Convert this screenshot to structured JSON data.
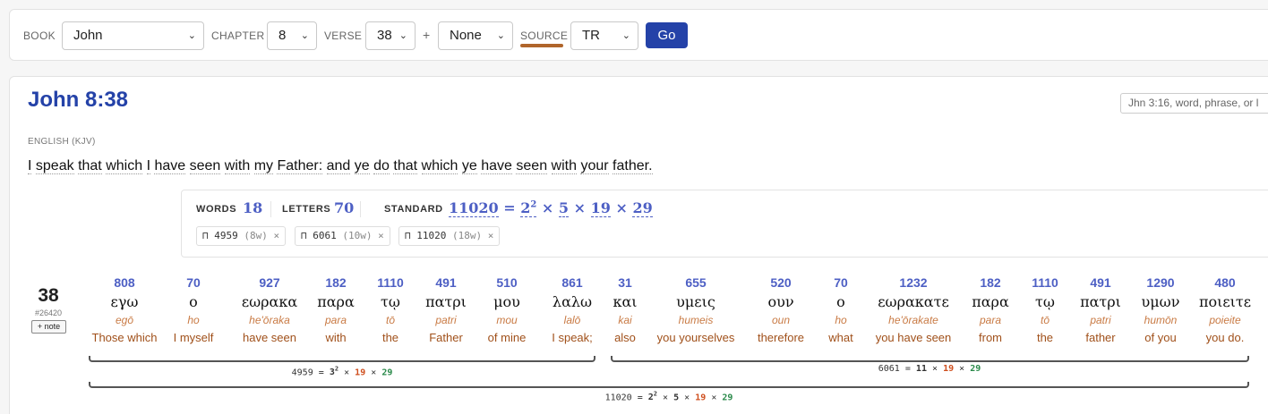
{
  "toolbar": {
    "book_label": "BOOK",
    "book_value": "John",
    "chapter_label": "CHAPTER",
    "chapter_value": "8",
    "verse_label": "VERSE",
    "verse_value": "38",
    "plus": "+",
    "range_value": "None",
    "source_label": "SOURCE",
    "source_value": "TR",
    "go_label": "Go",
    "chevron": "⌄",
    "accent_color": "#2442a8",
    "source_underline_color": "#b0652b"
  },
  "main": {
    "reference": "John 8:38",
    "search_placeholder": "Jhn 3:16, word, phrase, or l",
    "translation_label": "ENGLISH (KJV)",
    "english_words": [
      "I",
      "speak",
      "that",
      "which",
      "I",
      "have",
      "seen",
      "with",
      "my",
      "Father:",
      "and",
      "ye",
      "do",
      "that",
      "which",
      "ye",
      "have",
      "seen",
      "with",
      "your",
      "father."
    ]
  },
  "stats": {
    "words_label": "WORDS",
    "words_value": "18",
    "letters_label": "LETTERS",
    "letters_value": "70",
    "standard_label": "STANDARD",
    "standard_value": "11020",
    "eq": "=",
    "f1_base": "2",
    "f1_exp": "2",
    "times": "×",
    "f2": "5",
    "f3": "19",
    "f4": "29",
    "chips": [
      {
        "icon": "⊓",
        "value": "4959",
        "words": "(8w)",
        "close": "×"
      },
      {
        "icon": "⊓",
        "value": "6061",
        "words": "(10w)",
        "close": "×"
      },
      {
        "icon": "⊓",
        "value": "11020",
        "words": "(18w)",
        "close": "×"
      }
    ]
  },
  "verse": {
    "number": "38",
    "id": "#26420",
    "note_label": "+ note"
  },
  "words": [
    {
      "num": "808",
      "greek": "εγω",
      "translit": "egō",
      "gloss": "Those which"
    },
    {
      "num": "70",
      "greek": "ο",
      "translit": "ho",
      "gloss": "I myself"
    },
    {
      "num": "927",
      "greek": "εωρακα",
      "translit": "he'ōraka",
      "gloss": "have seen"
    },
    {
      "num": "182",
      "greek": "παρα",
      "translit": "para",
      "gloss": "with"
    },
    {
      "num": "1110",
      "greek": "τῳ",
      "translit": "tō",
      "gloss": "the"
    },
    {
      "num": "491",
      "greek": "πατρι",
      "translit": "patri",
      "gloss": "Father"
    },
    {
      "num": "510",
      "greek": "μου",
      "translit": "mou",
      "gloss": "of mine"
    },
    {
      "num": "861",
      "greek": "λαλω",
      "translit": "lalō",
      "gloss": "I speak;"
    },
    {
      "num": "31",
      "greek": "και",
      "translit": "kai",
      "gloss": "also"
    },
    {
      "num": "655",
      "greek": "υμεις",
      "translit": "humeis",
      "gloss": "you yourselves"
    },
    {
      "num": "520",
      "greek": "ουν",
      "translit": "oun",
      "gloss": "therefore"
    },
    {
      "num": "70",
      "greek": "ο",
      "translit": "ho",
      "gloss": "what"
    },
    {
      "num": "1232",
      "greek": "εωρακατε",
      "translit": "he'ōrakate",
      "gloss": "you have seen"
    },
    {
      "num": "182",
      "greek": "παρα",
      "translit": "para",
      "gloss": "from"
    },
    {
      "num": "1110",
      "greek": "τῳ",
      "translit": "tō",
      "gloss": "the"
    },
    {
      "num": "491",
      "greek": "πατρι",
      "translit": "patri",
      "gloss": "father"
    },
    {
      "num": "1290",
      "greek": "υμων",
      "translit": "humōn",
      "gloss": "of you"
    },
    {
      "num": "480",
      "greek": "ποιειτε",
      "translit": "poieite",
      "gloss": "you do."
    }
  ],
  "brackets": {
    "b1": {
      "value": "4959",
      "eq": "=",
      "f1_base": "3",
      "f1_exp": "2",
      "times": "×",
      "f2": "19",
      "f3": "29"
    },
    "b2": {
      "value": "6061",
      "eq": "=",
      "f1": "11",
      "times": "×",
      "f2": "19",
      "f3": "29"
    },
    "b3": {
      "value": "11020",
      "eq": "=",
      "f1_base": "2",
      "f1_exp": "2",
      "times": "×",
      "f2": "5",
      "f3": "19",
      "f4": "29"
    }
  }
}
